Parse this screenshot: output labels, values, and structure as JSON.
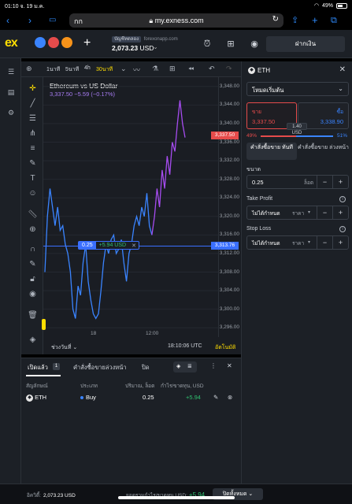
{
  "status_bar": {
    "time": "01:10",
    "date": "จ. 19 ม.ค.",
    "battery": "49%"
  },
  "browser": {
    "text_size_label": "กก",
    "url": "my.exness.com"
  },
  "header": {
    "logo": "ex",
    "account_type": "บัญชีทดลอง",
    "server": "forexonapp.com",
    "balance": "2,073.23",
    "currency": "USD",
    "deposit_label": "ฝากเงิน"
  },
  "chart_toolbar": {
    "timeframes": [
      "1นาที",
      "5นาที",
      "4h",
      "30นาที"
    ],
    "active_timeframe": "30นาที"
  },
  "chart_data": {
    "type": "line",
    "title": "Ethereum vs US Dollar",
    "subtitle": "3,337.50 −5.59 (−0.17%)",
    "current_price": "3,337.50",
    "position_price": "3,313.76",
    "x_tick_labels": [
      "18",
      "12:00"
    ],
    "y_ticks": [
      3348,
      3344,
      3340,
      3336,
      3332,
      3328,
      3324,
      3320,
      3316,
      3312,
      3308,
      3304,
      3300,
      3296
    ],
    "ylim": [
      3294,
      3350
    ],
    "series": [
      {
        "color": "#3a84ff",
        "values": [
          3308,
          3320,
          3326,
          3322,
          3318,
          3322,
          3317,
          3318,
          3314,
          3312,
          3308,
          3300,
          3298,
          3305,
          3303,
          3310,
          3314,
          3306,
          3302,
          3299,
          3298,
          3299,
          3304,
          3310,
          3314,
          3312,
          3315,
          3316,
          3312,
          3313,
          3315,
          3310,
          3306,
          3312,
          3314,
          3318,
          3320,
          3318,
          3322,
          3320,
          3325,
          3318,
          3316
        ]
      },
      {
        "color": "#a64cf0",
        "values": [
          3316,
          3320,
          3326,
          3322,
          3330,
          3326,
          3333,
          3329,
          3336,
          3334,
          3340,
          3345,
          3340,
          3337
        ]
      }
    ]
  },
  "chart_footer": {
    "range_label": "ช่วงวันที่",
    "clock": "18:10:06 UTC",
    "auto_label": "อัตโนมัติ"
  },
  "position_tag": {
    "lot": "0.25",
    "pl": "+5.94 USD"
  },
  "order_panel": {
    "symbol": "ETH",
    "mode": "โหมดเริ่มต้น",
    "sell_label": "ขาย",
    "sell_price": "3,337.50",
    "buy_label": "ซื้อ",
    "buy_price": "3,338.90",
    "spread": "1.40 USD",
    "sell_pct": "49%",
    "buy_pct": "51%",
    "sell_share": 0.49,
    "tab_market": "คำสั่งซื้อขาย ทันที",
    "tab_pending": "คำสั่งซื้อขาย ล่วงหน้า",
    "volume_label": "ขนาด",
    "volume_value": "0.25",
    "volume_unit": "ล็อต",
    "tp_label": "Take Profit",
    "tp_value": "ไม่ได้กำหนด",
    "tp_unit": "ราคา",
    "sl_label": "Stop Loss",
    "sl_value": "ไม่ได้กำหนด",
    "sl_unit": "ราคา"
  },
  "positions": {
    "tab_open": "เปิดแล้ว",
    "open_count": "1",
    "tab_pending": "คำสั่งซื้อขายล่วงหน้า",
    "tab_closed": "ปิด",
    "headers": [
      "สัญลักษณ์",
      "ประเภท",
      "ปริมาณ, ล็อต",
      "กำไร/ขาดทุน, USD"
    ],
    "rows": [
      {
        "symbol": "ETH",
        "type": "Buy",
        "volume": "0.25",
        "pl": "+5.94"
      }
    ]
  },
  "footer": {
    "equity_label": "อิควิตี้:",
    "equity_value": "2,073.23 USD",
    "total_pl_label": "ยอดรวมกำไร/ขาดทุน USD:",
    "total_pl_value": "+5.94",
    "close_all_label": "ปิดทั้งหมด"
  }
}
